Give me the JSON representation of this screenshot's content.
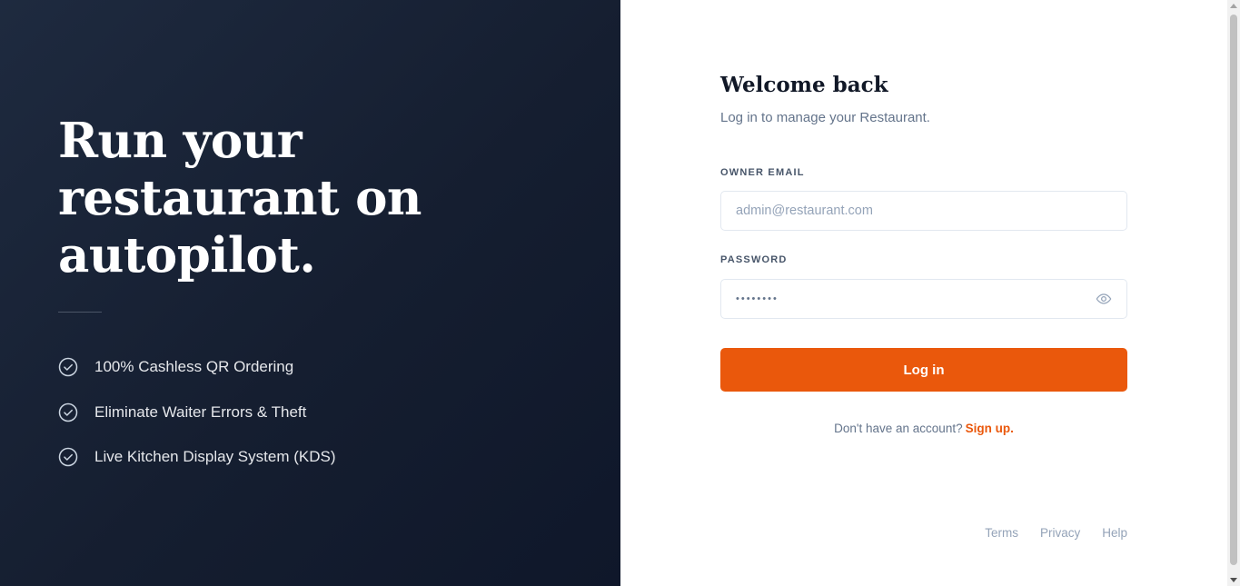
{
  "brand_panel": {
    "headline_lines": [
      "Run your",
      "restaurant on",
      "autopilot."
    ],
    "features": [
      {
        "icon": "check-circle-icon",
        "label": "100% Cashless QR Ordering"
      },
      {
        "icon": "check-circle-icon",
        "label": "Eliminate Waiter Errors & Theft"
      },
      {
        "icon": "check-circle-icon",
        "label": "Live Kitchen Display System (KDS)"
      }
    ]
  },
  "login": {
    "title": "Welcome back",
    "subtitle": "Log in to manage your Restaurant.",
    "email_label": "OWNER EMAIL",
    "email_placeholder": "admin@restaurant.com",
    "password_label": "PASSWORD",
    "password_masked": "••••••••",
    "show_password_icon": "eye-icon",
    "submit_label": "Log in",
    "signup_prompt": "Don't have an account?",
    "signup_link": "Sign up."
  },
  "footer": {
    "links": [
      "Terms",
      "Privacy",
      "Help"
    ]
  },
  "colors": {
    "accent": "#ea580c",
    "panel_bg": "#151e30"
  }
}
